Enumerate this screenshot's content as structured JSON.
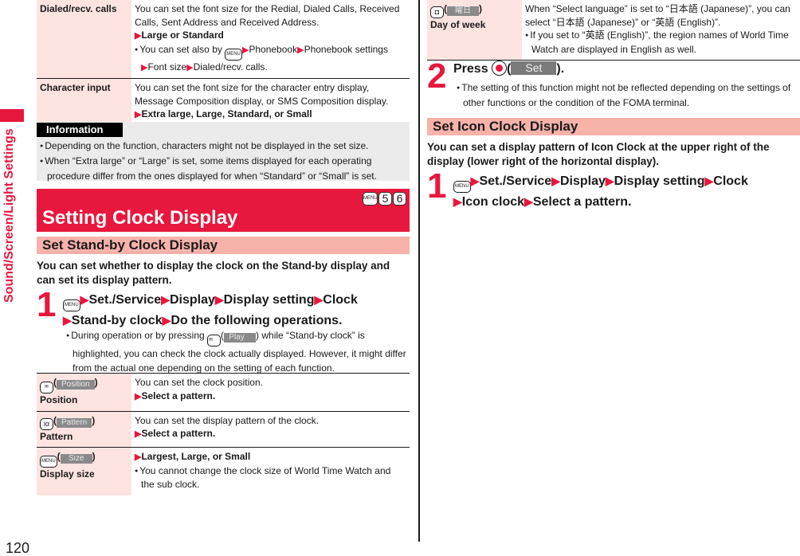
{
  "sidebar": {
    "section_label": "Sound/Screen/Light Settings",
    "accent": "#e8173d"
  },
  "page_number": "120",
  "top_table": [
    {
      "key": "Dialed/recv. calls",
      "desc": "You can set the font size for the Redial, Dialed Calls, Received Calls, Sent Address and Received Address.",
      "choice": "Large or Standard",
      "note_prefix": "You can set also by",
      "note_key": "MENU",
      "note_path": [
        "Phonebook",
        "Phonebook settings",
        "Font size",
        "Dialed/recv. calls."
      ]
    },
    {
      "key": "Character input",
      "desc": "You can set the font size for the character entry display, Message Composition display, or SMS Composition display.",
      "choice": "Extra large, Large, Standard, or Small"
    }
  ],
  "information": {
    "label": "Information",
    "items": [
      "Depending on the function, characters might not be displayed in the set size.",
      "When “Extra large” or “Large” is set, some items displayed for each operating procedure differ from the ones displayed for when “Standard” or “Small” is set."
    ]
  },
  "banner": {
    "title": "Setting Clock Display",
    "keys": [
      "MENU",
      "5",
      "6"
    ]
  },
  "standby_section": {
    "heading": "Set Stand-by Clock Display",
    "lead": "You can set whether to display the clock on the Stand-by display and can set its display pattern.",
    "step1": {
      "num": "1",
      "key": "MENU",
      "path": [
        "Set./Service",
        "Display",
        "Display setting",
        "Clock",
        "Stand-by clock",
        "Do the following operations."
      ],
      "note_a": "During operation or by pressing",
      "note_label": "Play",
      "note_b": "while “Stand-by clock” is highlighted, you can check the clock actually displayed. However, it might differ from the actual one depending on the setting of each function."
    },
    "ops": [
      {
        "key_icon": "mail",
        "soft": "Position",
        "name": "Position",
        "desc": "You can set the clock position.",
        "choice": "Select a pattern."
      },
      {
        "key_icon": "i-appli",
        "soft": "Pattern",
        "name": "Pattern",
        "desc": "You can set the display pattern of the clock.",
        "choice": "Select a pattern."
      },
      {
        "key_icon": "MENU",
        "soft": "Size",
        "name": "Display size",
        "choice": "Largest, Large, or Small",
        "note": "You cannot change the clock size of World Time Watch and the sub clock."
      }
    ]
  },
  "right_top_row": {
    "key_icon": "camera",
    "soft": "曜日",
    "name": "Day of week",
    "desc": "When “Select language” is set to “日本語 (Japanese)”, you can select “日本語 (Japanese)” or “英語 (English)”.",
    "note": "If you set to “英語 (English)”, the region names of World Time Watch are displayed in English as well."
  },
  "step2": {
    "num": "2",
    "text_a": "Press",
    "label": "Set",
    "text_b": ").",
    "note": "The setting of this function might not be reflected depending on the settings of other functions or the condition of the FOMA terminal."
  },
  "icon_section": {
    "heading": "Set Icon Clock Display",
    "lead": "You can set a display pattern of Icon Clock at the upper right of the display (lower right of the horizontal display).",
    "step1": {
      "num": "1",
      "key": "MENU",
      "path": [
        "Set./Service",
        "Display",
        "Display setting",
        "Clock",
        "Icon clock",
        "Select a pattern."
      ]
    }
  }
}
